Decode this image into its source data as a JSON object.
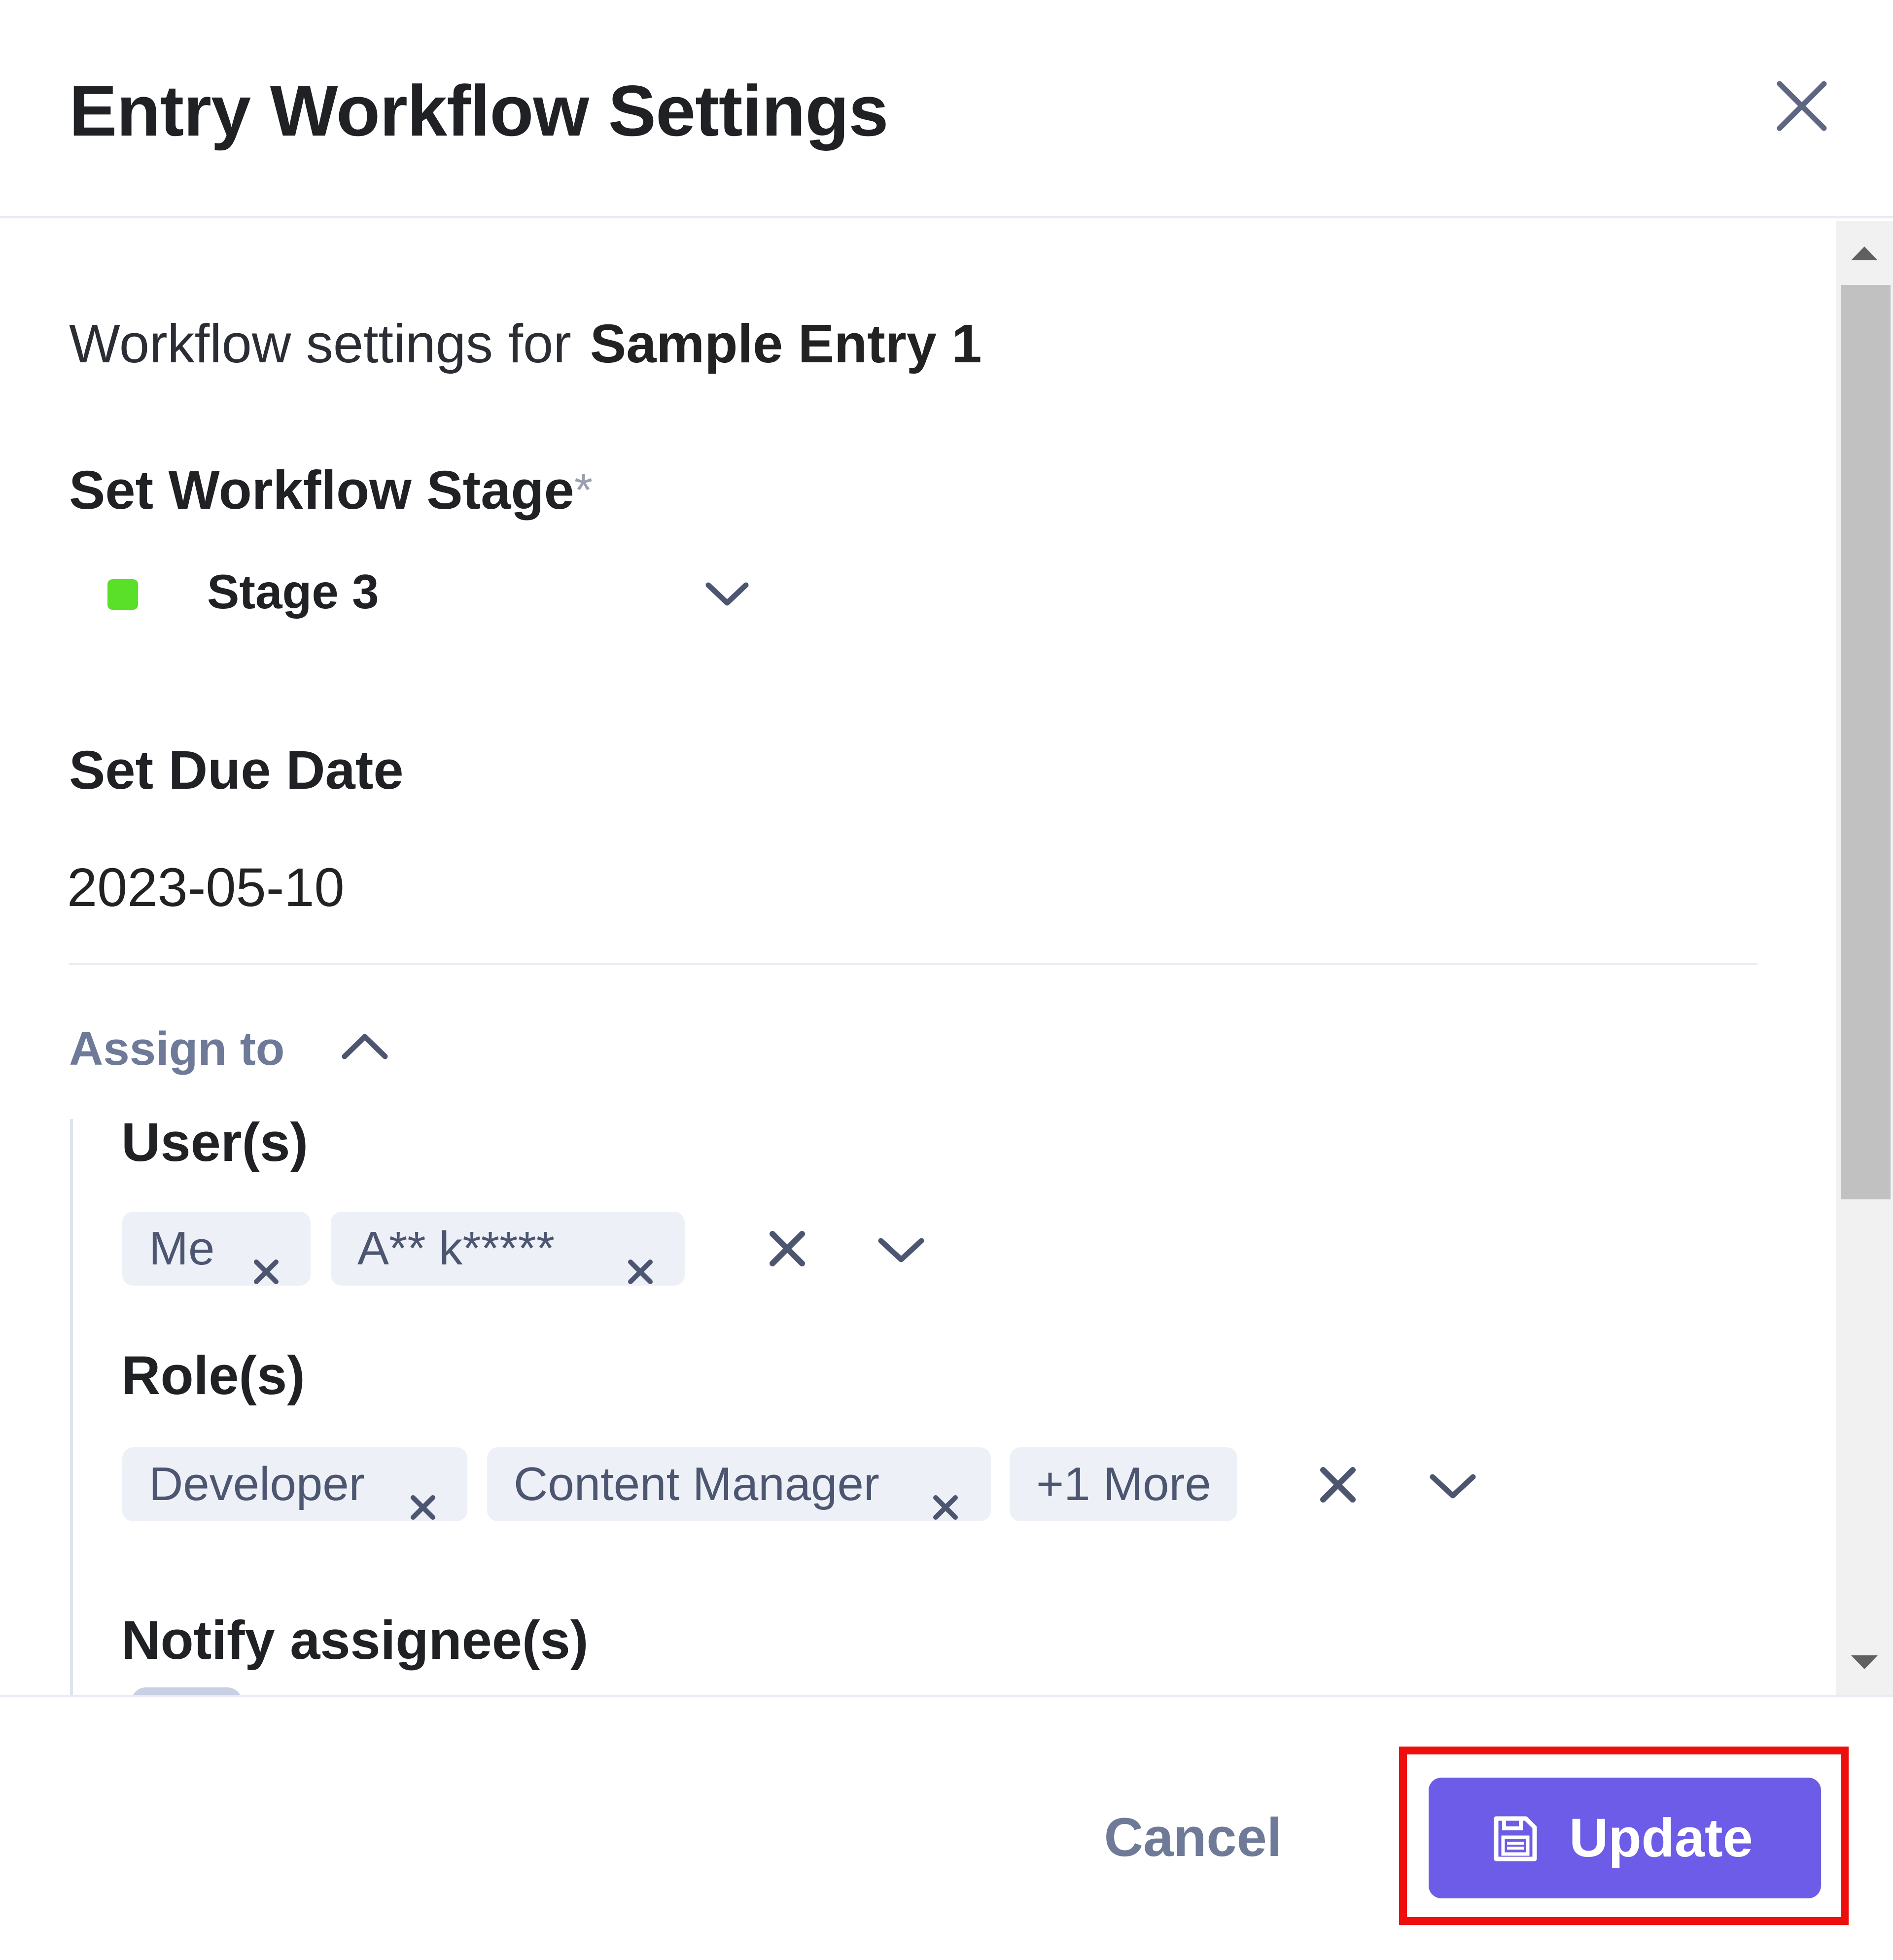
{
  "modal": {
    "title": "Entry Workflow Settings",
    "close_icon": "close-icon"
  },
  "intro": {
    "prefix": "Workflow settings for",
    "entry_name": "Sample Entry 1"
  },
  "workflow_stage": {
    "label": "Set Workflow Stage",
    "required_mark": "*",
    "selected": "Stage 3",
    "stage_color": "#5be02a"
  },
  "due_date": {
    "label": "Set Due Date",
    "value": "2023-05-10"
  },
  "assign": {
    "label": "Assign to",
    "users": {
      "label": "User(s)",
      "chips": [
        "Me",
        "A** k*****"
      ]
    },
    "roles": {
      "label": "Role(s)",
      "chips": [
        "Developer",
        "Content Manager"
      ],
      "more": "+1 More"
    },
    "notify_label": "Notify assignee(s)"
  },
  "footer": {
    "cancel_label": "Cancel",
    "update_label": "Update",
    "accent_color": "#6c5ce7",
    "highlight_color": "#ee0e0e"
  }
}
